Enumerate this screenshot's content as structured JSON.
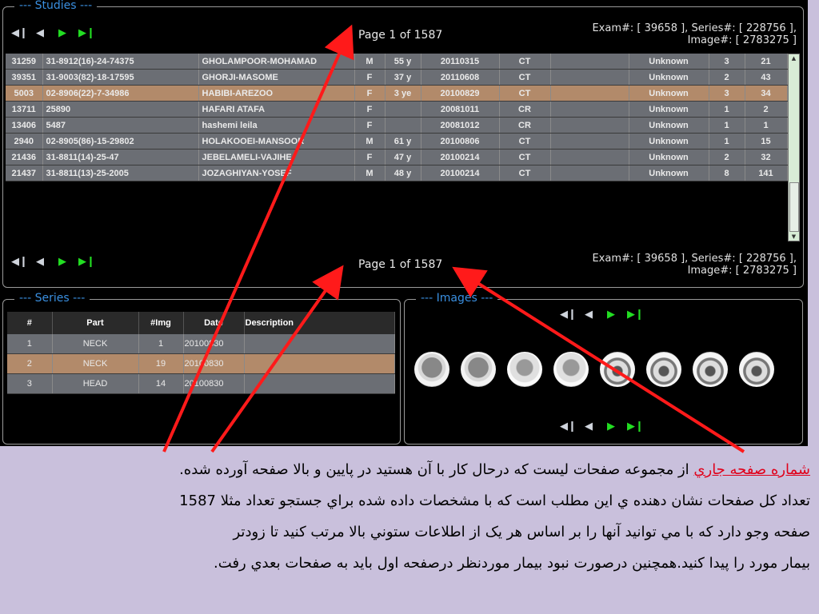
{
  "studies": {
    "title": "--- Studies ---",
    "page_text": "Page 1 of 1587",
    "exam_line1": "Exam#: [ 39658 ], Series#: [ 228756 ],",
    "exam_line2": "Image#: [ 2783275 ]",
    "rows": [
      [
        "31259",
        "31-8912(16)-24-74375",
        "GHOLAMPOOR-MOHAMAD",
        "M",
        "55 y",
        "20110315",
        "CT",
        "",
        "Unknown",
        "3",
        "21"
      ],
      [
        "39351",
        "31-9003(82)-18-17595",
        "GHORJI-MASOME",
        "F",
        "37 y",
        "20110608",
        "CT",
        "",
        "Unknown",
        "2",
        "43"
      ],
      [
        "5003",
        "02-8906(22)-7-34986",
        "HABIBI-AREZOO",
        "F",
        "3 ye",
        "20100829",
        "CT",
        "",
        "Unknown",
        "3",
        "34"
      ],
      [
        "13711",
        "25890",
        "HAFARI ATAFA",
        "F",
        "",
        "20081011",
        "CR",
        "",
        "Unknown",
        "1",
        "2"
      ],
      [
        "13406",
        "5487",
        "hashemi leila",
        "F",
        "",
        "20081012",
        "CR",
        "",
        "Unknown",
        "1",
        "1"
      ],
      [
        "2940",
        "02-8905(86)-15-29802",
        "HOLAKOOEI-MANSOOR",
        "M",
        "61 y",
        "20100806",
        "CT",
        "",
        "Unknown",
        "1",
        "15"
      ],
      [
        "21436",
        "31-8811(14)-25-47",
        "JEBELAMELI-VAJIHE",
        "F",
        "47 y",
        "20100214",
        "CT",
        "",
        "Unknown",
        "2",
        "32"
      ],
      [
        "21437",
        "31-8811(13)-25-2005",
        "JOZAGHIYAN-YOSEF",
        "M",
        "48 y",
        "20100214",
        "CT",
        "",
        "Unknown",
        "8",
        "141"
      ]
    ],
    "selected_row": 2
  },
  "series": {
    "title": "--- Series ---",
    "headers": [
      "#",
      "Part",
      "#Img",
      "Date",
      "Description"
    ],
    "rows": [
      [
        "1",
        "NECK",
        "1",
        "20100830",
        ""
      ],
      [
        "2",
        "NECK",
        "19",
        "20100830",
        ""
      ],
      [
        "3",
        "HEAD",
        "14",
        "20100830",
        ""
      ]
    ],
    "selected_row": 1
  },
  "images": {
    "title": "--- Images ---",
    "thumb_count": 8
  },
  "nav_icons": [
    "first-icon",
    "prev-icon",
    "next-icon",
    "last-icon"
  ],
  "caption": {
    "highlight": "شماره صفحه جاري",
    "line1_rest": " از مجموعه صفحات ليست كه درحال كار با آن هستيد در پايين و بالا صفحه  آورده شده.",
    "line2": "تعداد كل صفحات نشان دهنده ي اين مطلب است كه با مشخصات داده شده براي جستجو تعداد مثلا 1587",
    "line3": "صفحه  وجو دارد كه با مي توانيد آنها را بر اساس هر يک از اطلاعات ستوني بالا مرتب كنيد تا زودتر",
    "line4": "بيمار مورد را پيدا كنيد.همچنين درصورت نبود بيمار موردنظر درصفحه اول بايد به صفحات بعدي رفت."
  },
  "colors": {
    "arrow": "#ff1a1a",
    "title": "#3a8fe0",
    "selected_row": "#b28a6a",
    "row": "#6b6e74"
  }
}
